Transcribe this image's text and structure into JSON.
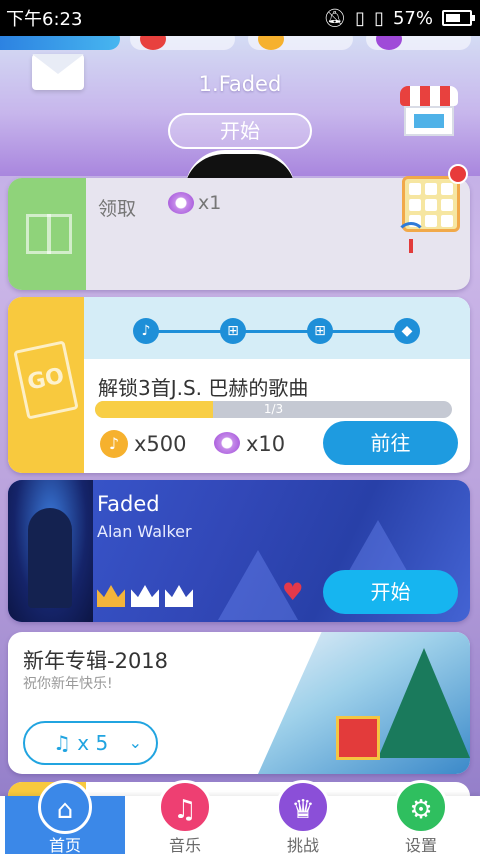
{
  "status_bar": {
    "time": "下午6:23",
    "battery": "57%"
  },
  "header": {
    "song_title": "1.Faded",
    "start_label": "开始"
  },
  "claim_card": {
    "label": "领取",
    "diamond_count": "x1"
  },
  "task_card": {
    "title": "解锁3首J.S. 巴赫的歌曲",
    "progress_text": "1/3",
    "progress_fraction": 0.33,
    "coin_reward": "x500",
    "diamond_reward": "x10",
    "go_label": "前往"
  },
  "song_card": {
    "song": "Faded",
    "artist": "Alan Walker",
    "start_label": "开始",
    "crowns_earned": 1,
    "crowns_total": 3
  },
  "album_card": {
    "title": "新年专辑-2018",
    "subtitle": "祝你新年快乐!",
    "filter_label": "x 5"
  },
  "bottom_nav": {
    "items": [
      {
        "label": "首页",
        "icon": "home-icon",
        "color": "#3b88e8"
      },
      {
        "label": "音乐",
        "icon": "music-icon",
        "color": "#ee3f72"
      },
      {
        "label": "挑战",
        "icon": "trophy-icon",
        "color": "#8b4fd8"
      },
      {
        "label": "设置",
        "icon": "gear-icon",
        "color": "#2fbf5f"
      }
    ]
  },
  "colors": {
    "accent_blue": "#1e9be0",
    "gold": "#f8ce45",
    "green": "#8fd37a"
  }
}
